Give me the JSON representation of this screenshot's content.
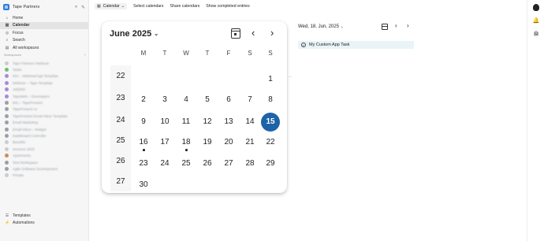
{
  "sidebar": {
    "workspace_name": "Tape Partners",
    "collapse_label": "«",
    "new_label": "✎",
    "nav": [
      {
        "label": "Home",
        "icon": "⌂"
      },
      {
        "label": "Calendar",
        "icon": "▦",
        "active": true
      },
      {
        "label": "Focus",
        "icon": "◎"
      },
      {
        "label": "Search",
        "icon": "⌕"
      },
      {
        "label": "All workspaces",
        "icon": "▤"
      }
    ],
    "workspaces_label": "Workspaces",
    "workspaces_add": "+",
    "workspaces": [
      {
        "name": "Tape Partners Webinar",
        "color": "#c9cdd3"
      },
      {
        "name": "Tasks",
        "color": "#6cc070"
      },
      {
        "name": "001 – Webinar/App Template",
        "color": "#a78bd8"
      },
      {
        "name": "Webinar – Tape Template",
        "color": "#a78bd8"
      },
      {
        "name": "Jellyfish",
        "color": "#a78bd8"
      },
      {
        "name": "TapeWeb – Developers",
        "color": "#a78bd8"
      },
      {
        "name": "001 – TapePresent",
        "color": "#9aa0a8"
      },
      {
        "name": "TapePresent v1",
        "color": "#9aa0a8"
      },
      {
        "name": "TapePresent Email Inbox Template",
        "color": "#9aa0a8"
      },
      {
        "name": "Email Marketing",
        "color": "#9aa0a8"
      },
      {
        "name": "Email Inbox – Widget",
        "color": "#9aa0a8"
      },
      {
        "name": "Dashboard Controller",
        "color": "#9aa0a8"
      },
      {
        "name": "Benefits",
        "color": "#c9cdd3"
      },
      {
        "name": "Invoices 2025",
        "color": "#c9cdd3"
      },
      {
        "name": "Apartments",
        "color": "#d08a5c"
      },
      {
        "name": "Test Workspace",
        "color": "#9aa0a8"
      },
      {
        "name": "Agile Software Development",
        "color": "#9aa0a8"
      },
      {
        "name": "Private",
        "color": "#c9cdd3"
      }
    ],
    "footer": [
      {
        "label": "Templates",
        "icon": "☰"
      },
      {
        "label": "Automations",
        "icon": "⚡"
      }
    ]
  },
  "toolbar": {
    "calendar_label": "Calendar",
    "calendar_icon": "▦",
    "calendar_caret": "⌄",
    "select_calendars": "Select calendars",
    "share_calendars": "Share calendars",
    "show_completed": "Show completed entries"
  },
  "calendar": {
    "month_label": "June 2025",
    "caret": "⌄",
    "prev": "‹",
    "next": "›",
    "weekdays": [
      "M",
      "T",
      "W",
      "T",
      "F",
      "S",
      "S"
    ],
    "week_numbers": [
      "22",
      "23",
      "24",
      "25",
      "26",
      "27"
    ],
    "days": [
      {
        "d": "1",
        "col": 6,
        "row": 0
      },
      {
        "d": "2",
        "col": 0,
        "row": 1
      },
      {
        "d": "3",
        "col": 1,
        "row": 1
      },
      {
        "d": "4",
        "col": 2,
        "row": 1
      },
      {
        "d": "5",
        "col": 3,
        "row": 1
      },
      {
        "d": "6",
        "col": 4,
        "row": 1
      },
      {
        "d": "7",
        "col": 5,
        "row": 1
      },
      {
        "d": "8",
        "col": 6,
        "row": 1
      },
      {
        "d": "9",
        "col": 0,
        "row": 2
      },
      {
        "d": "10",
        "col": 1,
        "row": 2
      },
      {
        "d": "11",
        "col": 2,
        "row": 2
      },
      {
        "d": "12",
        "col": 3,
        "row": 2
      },
      {
        "d": "13",
        "col": 4,
        "row": 2
      },
      {
        "d": "14",
        "col": 5,
        "row": 2
      },
      {
        "d": "15",
        "col": 6,
        "row": 2,
        "selected": true
      },
      {
        "d": "16",
        "col": 0,
        "row": 3,
        "dot": true
      },
      {
        "d": "17",
        "col": 1,
        "row": 3
      },
      {
        "d": "18",
        "col": 2,
        "row": 3,
        "dot": true
      },
      {
        "d": "19",
        "col": 3,
        "row": 3
      },
      {
        "d": "20",
        "col": 4,
        "row": 3
      },
      {
        "d": "21",
        "col": 5,
        "row": 3
      },
      {
        "d": "22",
        "col": 6,
        "row": 3
      },
      {
        "d": "23",
        "col": 0,
        "row": 4
      },
      {
        "d": "24",
        "col": 1,
        "row": 4
      },
      {
        "d": "25",
        "col": 2,
        "row": 4
      },
      {
        "d": "26",
        "col": 3,
        "row": 4
      },
      {
        "d": "27",
        "col": 4,
        "row": 4
      },
      {
        "d": "28",
        "col": 5,
        "row": 4
      },
      {
        "d": "29",
        "col": 6,
        "row": 4
      },
      {
        "d": "30",
        "col": 0,
        "row": 5
      }
    ]
  },
  "day_panel": {
    "date_label": "Wed, 18. Jun, 2025",
    "caret": "⌄",
    "prev": "‹",
    "next": "›",
    "task_label": "My Custom App Task",
    "task_check": "✓"
  },
  "rail": {
    "bell_icon": "🔔",
    "apps_icon": "⊙",
    "mail_icon": "✉"
  },
  "colors": {
    "accent": "#1e63a8",
    "task_bg": "#e9f3f8"
  }
}
